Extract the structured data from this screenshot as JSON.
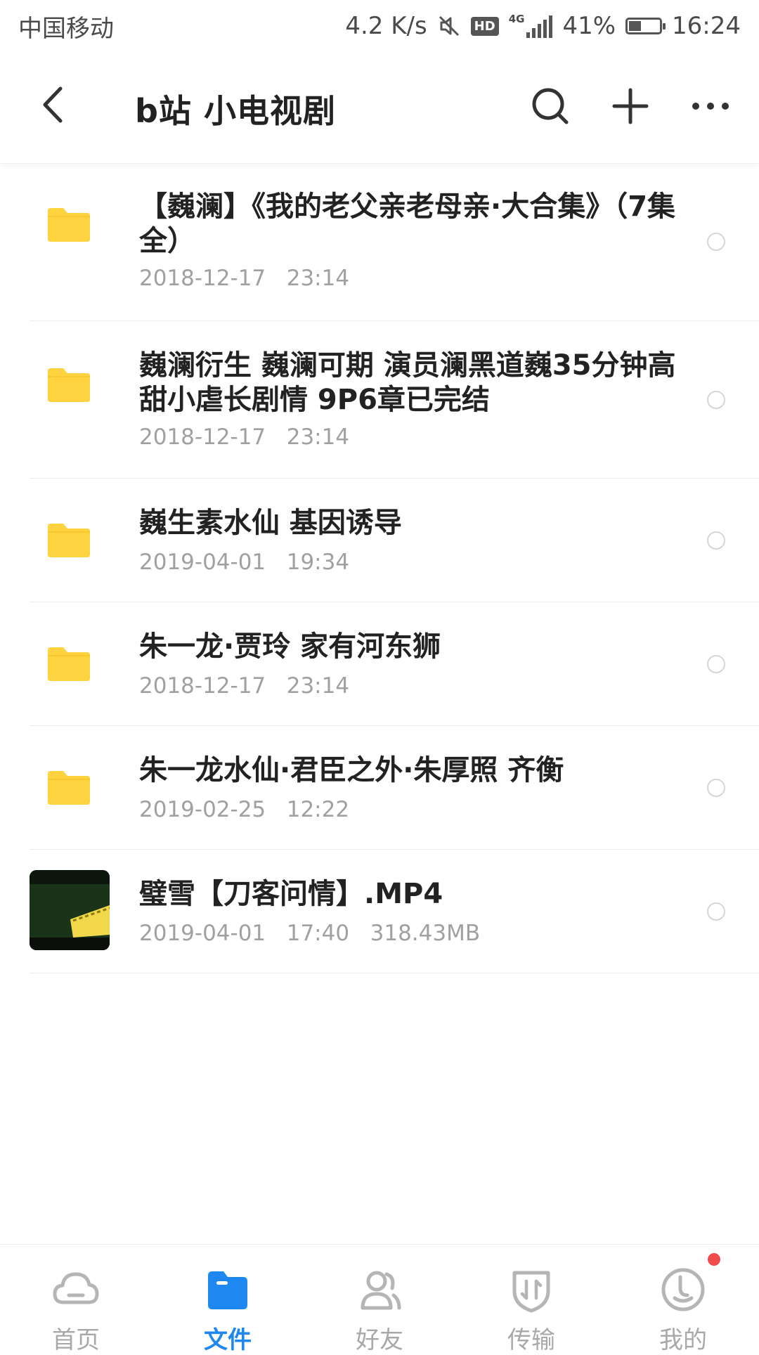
{
  "status_bar": {
    "carrier": "中国移动",
    "network_speed": "4.2 K/s",
    "hd_label": "HD",
    "network_type": "4G",
    "battery_percent": "41%",
    "battery_level": 0.41,
    "time": "16:24",
    "icons": [
      "mute-icon",
      "hd-icon",
      "signal-icon",
      "battery-icon"
    ]
  },
  "header": {
    "title": "b站 小电视剧",
    "icons": [
      "back-arrow-icon",
      "search-icon",
      "plus-icon",
      "more-dots-icon"
    ]
  },
  "files": [
    {
      "type": "folder",
      "name": "【巍澜】《我的老父亲老母亲·大合集》（7集全）",
      "meta": "2018-12-17   23:14"
    },
    {
      "type": "folder",
      "name": "巍澜衍生 巍澜可期 演员澜黑道巍35分钟高甜小虐长剧情 9P6章已完结",
      "meta": "2018-12-17   23:14"
    },
    {
      "type": "folder",
      "name": "巍生素水仙 基因诱导",
      "meta": "2019-04-01   19:34"
    },
    {
      "type": "folder",
      "name": "朱一龙·贾玲 家有河东狮",
      "meta": "2018-12-17   23:14"
    },
    {
      "type": "folder",
      "name": "朱一龙水仙·君臣之外·朱厚照 齐衡",
      "meta": "2019-02-25   12:22"
    },
    {
      "type": "video",
      "name": "璧雪【刀客问情】.MP4",
      "meta": "2019-04-01   17:40   318.43MB"
    }
  ],
  "colors": {
    "folder": "#FFD23F",
    "accent": "#1E88F0",
    "inactive": "#A8A8A8",
    "badge": "#F24B4B"
  },
  "bottom_nav": [
    {
      "label": "首页",
      "icon": "cloud-icon",
      "active": false
    },
    {
      "label": "文件",
      "icon": "folder-icon",
      "active": true
    },
    {
      "label": "好友",
      "icon": "friends-icon",
      "active": false
    },
    {
      "label": "传输",
      "icon": "transfer-shield-icon",
      "active": false
    },
    {
      "label": "我的",
      "icon": "profile-face-icon",
      "active": false,
      "has_notification": true
    }
  ]
}
